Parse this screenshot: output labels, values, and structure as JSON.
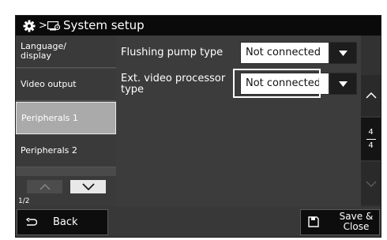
{
  "header": {
    "breadcrumb_sep": ">",
    "title": "System setup"
  },
  "sidebar": {
    "items": [
      {
        "label": "Language/ display",
        "active": false
      },
      {
        "label": "Video output",
        "active": false
      },
      {
        "label": "Peripherals 1",
        "active": true
      },
      {
        "label": "Peripherals 2",
        "active": false
      }
    ],
    "page": "1/2"
  },
  "settings": [
    {
      "label": "Flushing pump type",
      "value": "Not connected"
    },
    {
      "label": "Ext. video processor type",
      "value": "Not connected"
    }
  ],
  "scroll": {
    "current_page": "4",
    "total_pages": "4"
  },
  "footer": {
    "back_label": "Back",
    "save_label": "Save & Close"
  },
  "icons": {
    "settings": "gear-icon",
    "breadcrumb_screen": "monitor-gear-icon",
    "back": "back-arrow-icon",
    "save": "save-disk-icon",
    "dropdown": "triangle-down-icon",
    "page_up": "chevron-up-icon",
    "page_down": "chevron-down-icon"
  },
  "colors": {
    "title_bar": "#0a0a0a",
    "panel": "#3f3f3f",
    "active_tab": "#aaaaaa",
    "text": "#ffffff",
    "highlight": "#ffffff"
  }
}
